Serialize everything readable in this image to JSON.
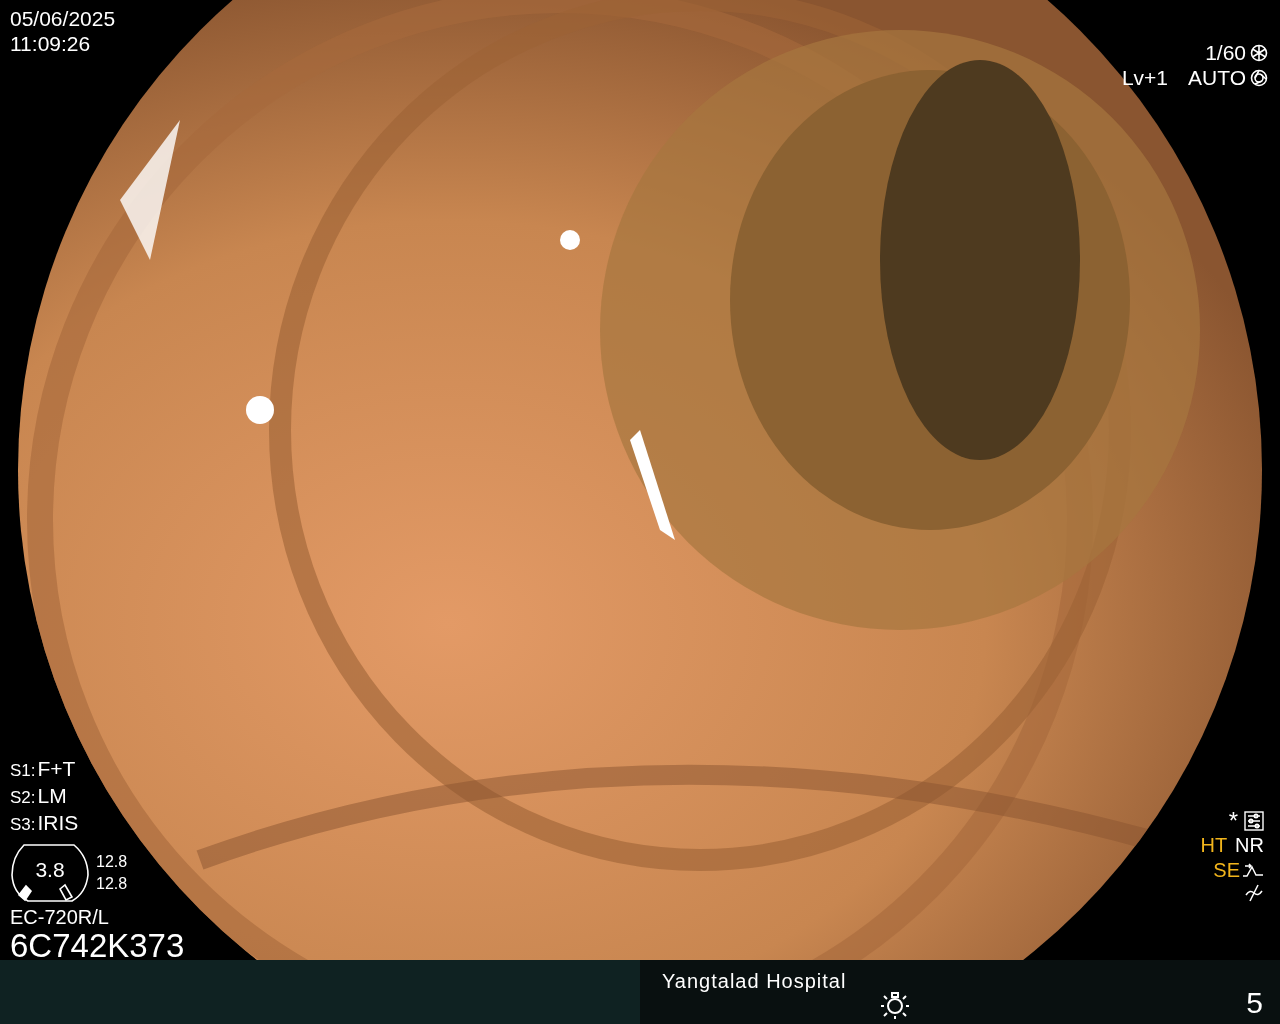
{
  "datetime": {
    "date": "05/06/2025",
    "time": "11:09:26"
  },
  "exposure": {
    "shutter": "1/60",
    "level": "Lv+1",
    "iris_mode": "AUTO"
  },
  "switches": [
    {
      "label": "S1:",
      "value": "F+T"
    },
    {
      "label": "S2:",
      "value": "LM"
    },
    {
      "label": "S3:",
      "value": "IRIS"
    }
  ],
  "gauge": {
    "center": "3.8",
    "readings": [
      "12.8",
      "12.8"
    ]
  },
  "scope": {
    "model": "EC-720R/L",
    "serial": "6C742K373"
  },
  "settings_mark": "*",
  "processing": [
    {
      "label": "HT",
      "active": true
    },
    {
      "label": "NR",
      "active": false
    }
  ],
  "enhancement": {
    "label": "SE",
    "active": true
  },
  "status_bar": {
    "hospital": "Yangtalad Hospital",
    "page": "5"
  }
}
